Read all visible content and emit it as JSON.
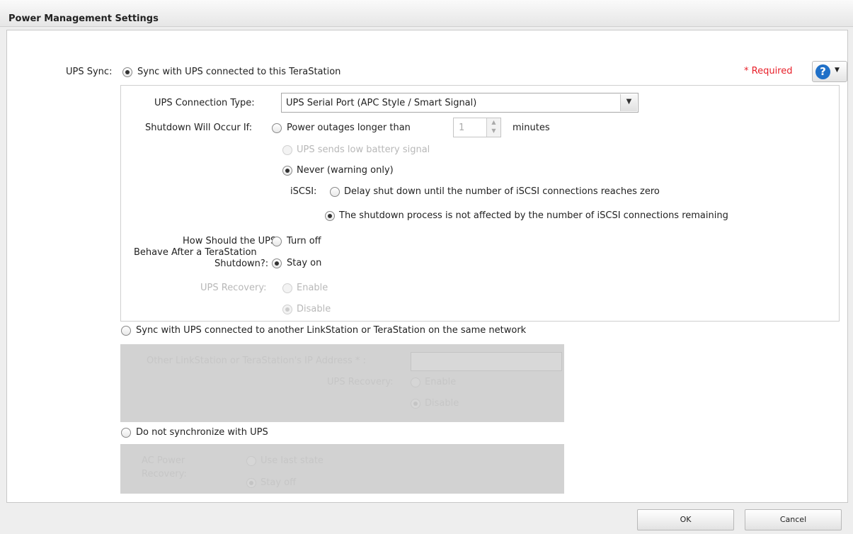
{
  "dialog": {
    "title": "Power Management Settings",
    "required_label": "* Required",
    "help_icon": "question-circle-icon"
  },
  "ups_sync": {
    "label": "UPS Sync:",
    "option_this": {
      "label": "Sync with UPS connected to this TeraStation",
      "selected": true
    },
    "connection_type": {
      "label": "UPS Connection Type:",
      "value": "UPS Serial Port (APC Style / Smart Signal)"
    },
    "shutdown": {
      "label": "Shutdown Will Occur If:",
      "option_outage": {
        "label": "Power outages longer than",
        "selected": false,
        "minutes_value": "1",
        "unit": "minutes"
      },
      "option_low_battery": {
        "label": "UPS sends low battery signal",
        "selected": false,
        "enabled": false
      },
      "option_never": {
        "label": "Never (warning only)",
        "selected": true
      }
    },
    "iscsi": {
      "label": "iSCSI:",
      "option_delay": {
        "label": "Delay shut down until the number of iSCSI connections reaches zero",
        "selected": false
      },
      "option_not_affected": {
        "label": "The shutdown process is not affected by the number of iSCSI connections remaining",
        "selected": true
      }
    },
    "behavior": {
      "label_line1": "How Should the UPS",
      "label_line2": "Behave After a TeraStation",
      "label_line3": "Shutdown?:",
      "option_off": {
        "label": "Turn off",
        "selected": false
      },
      "option_on": {
        "label": "Stay on",
        "selected": true
      }
    },
    "recovery": {
      "label": "UPS Recovery:",
      "option_enable": {
        "label": "Enable",
        "selected": false
      },
      "option_disable": {
        "label": "Disable",
        "selected": true
      }
    },
    "option_other": {
      "label": "Sync with UPS connected to another LinkStation or TeraStation on the same network",
      "selected": false,
      "ip_label": "Other LinkStation or TeraStation's IP Address * :",
      "recovery_label": "UPS Recovery:",
      "enable_label": "Enable",
      "disable_label": "Disable"
    },
    "option_none": {
      "label": "Do not synchronize with UPS",
      "selected": false,
      "ac_label_line1": "AC Power",
      "ac_label_line2": "Recovery:",
      "last_state_label": "Use last state",
      "stay_off_label": "Stay off"
    }
  },
  "footer": {
    "ok_label": "OK",
    "cancel_label": "Cancel"
  }
}
